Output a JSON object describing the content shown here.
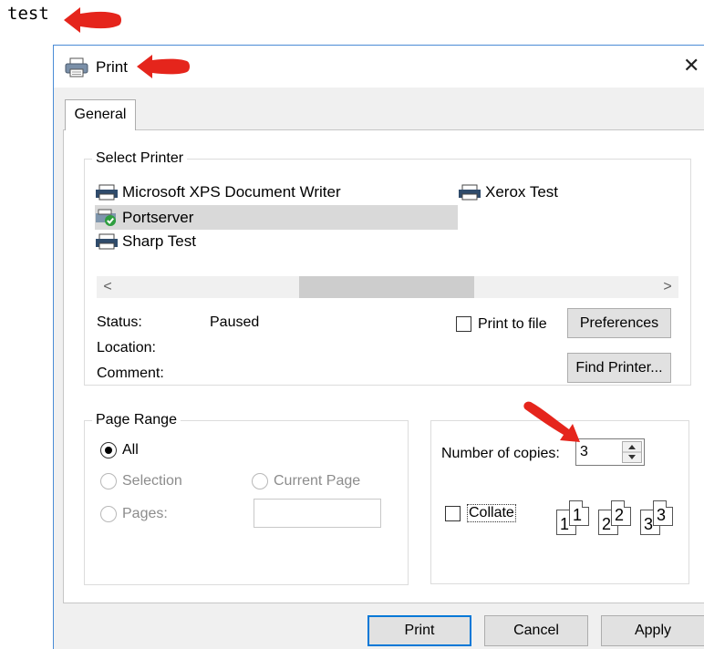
{
  "background_label": "test",
  "dialog": {
    "title": "Print",
    "close_glyph": "✕",
    "tab_general": "General",
    "select_printer": {
      "legend": "Select Printer",
      "printers": [
        {
          "name": "Microsoft XPS Document Writer",
          "icon": "printer-icon"
        },
        {
          "name": "Portserver",
          "icon": "printer-check-icon",
          "selected": true
        },
        {
          "name": "Sharp Test",
          "icon": "printer-icon"
        },
        {
          "name": "Xerox Test",
          "icon": "printer-icon"
        }
      ],
      "status_label": "Status:",
      "status_value": "Paused",
      "location_label": "Location:",
      "comment_label": "Comment:",
      "print_to_file_label": "Print to file",
      "preferences_button": "Preferences",
      "find_printer_button": "Find Printer..."
    },
    "page_range": {
      "legend": "Page Range",
      "all": "All",
      "selection": "Selection",
      "current_page": "Current Page",
      "pages": "Pages:"
    },
    "copies": {
      "number_label": "Number of copies:",
      "number_value": "3",
      "collate_label": "Collate",
      "collate_pages": [
        "1",
        "1",
        "2",
        "2",
        "3",
        "3"
      ]
    },
    "buttons": {
      "print": "Print",
      "cancel": "Cancel",
      "apply": "Apply"
    }
  },
  "colors": {
    "annotation_arrow": "#e5251c",
    "dialog_border": "#4a8cd6",
    "default_button_border": "#0078d7"
  }
}
